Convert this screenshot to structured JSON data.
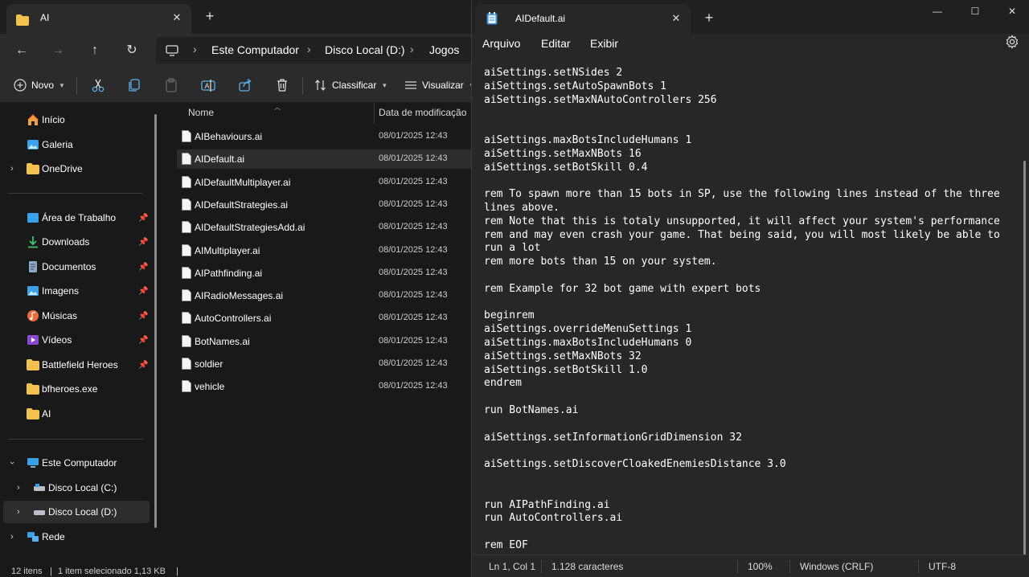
{
  "explorer": {
    "tab_title": "AI",
    "tab_close": "✕",
    "new_tab": "+",
    "nav": {
      "back": "←",
      "forward": "→",
      "up": "↑",
      "refresh": "↻"
    },
    "breadcrumb": [
      "Este Computador",
      "Disco Local (D:)",
      "Jogos"
    ],
    "toolbar": {
      "new_label": "Novo",
      "sort_label": "Classificar",
      "view_label": "Visualizar"
    },
    "sidebar": {
      "quick": [
        {
          "label": "Início",
          "icon": "home-icon"
        },
        {
          "label": "Galeria",
          "icon": "gallery-icon"
        },
        {
          "label": "OneDrive",
          "icon": "folder-icon"
        }
      ],
      "pinned": [
        {
          "label": "Área de Trabalho",
          "icon": "desktop-icon",
          "color": "#3aa0e8"
        },
        {
          "label": "Downloads",
          "icon": "download-icon",
          "color": "#3ec46d"
        },
        {
          "label": "Documentos",
          "icon": "documents-icon",
          "color": "#8fa7c7"
        },
        {
          "label": "Imagens",
          "icon": "images-icon",
          "color": "#3aa0e8"
        },
        {
          "label": "Músicas",
          "icon": "music-icon",
          "color": "#e86a3a"
        },
        {
          "label": "Vídeos",
          "icon": "videos-icon",
          "color": "#8a4ad0"
        },
        {
          "label": "Battlefield Heroes",
          "icon": "folder-icon",
          "color": "#f2c14e"
        },
        {
          "label": "bfheroes.exe",
          "icon": "folder-icon",
          "color": "#f2c14e"
        },
        {
          "label": "AI",
          "icon": "folder-icon",
          "color": "#f2c14e"
        }
      ],
      "drives": [
        {
          "label": "Este Computador",
          "icon": "pc-icon"
        },
        {
          "label": "Disco Local (C:)",
          "icon": "drive-icon"
        },
        {
          "label": "Disco Local (D:)",
          "icon": "drive-icon"
        },
        {
          "label": "Rede",
          "icon": "network-icon"
        }
      ]
    },
    "columns": {
      "name": "Nome",
      "date": "Data de modificação"
    },
    "files": [
      {
        "name": "AIBehaviours.ai",
        "date": "08/01/2025 12:43"
      },
      {
        "name": "AIDefault.ai",
        "date": "08/01/2025 12:43"
      },
      {
        "name": "AIDefaultMultiplayer.ai",
        "date": "08/01/2025 12:43"
      },
      {
        "name": "AIDefaultStrategies.ai",
        "date": "08/01/2025 12:43"
      },
      {
        "name": "AIDefaultStrategiesAdd.ai",
        "date": "08/01/2025 12:43"
      },
      {
        "name": "AIMultiplayer.ai",
        "date": "08/01/2025 12:43"
      },
      {
        "name": "AIPathfinding.ai",
        "date": "08/01/2025 12:43"
      },
      {
        "name": "AIRadioMessages.ai",
        "date": "08/01/2025 12:43"
      },
      {
        "name": "AutoControllers.ai",
        "date": "08/01/2025 12:43"
      },
      {
        "name": "BotNames.ai",
        "date": "08/01/2025 12:43"
      },
      {
        "name": "soldier",
        "date": "08/01/2025 12:43"
      },
      {
        "name": "vehicle",
        "date": "08/01/2025 12:43"
      }
    ],
    "status": {
      "count": "12 itens",
      "sep": "|",
      "selection": "1 item selecionado 1,13 KB",
      "sep2": "|"
    }
  },
  "notepad": {
    "tab_title": "AIDefault.ai",
    "tab_close": "✕",
    "new_tab": "+",
    "window": {
      "minimize": "—",
      "maximize": "☐",
      "close": "✕"
    },
    "menu": {
      "file": "Arquivo",
      "edit": "Editar",
      "view": "Exibir"
    },
    "content": "aiSettings.setNSides 2\naiSettings.setAutoSpawnBots 1\naiSettings.setMaxNAutoControllers 256\n\n\naiSettings.maxBotsIncludeHumans 1\naiSettings.setMaxNBots 16\naiSettings.setBotSkill 0.4\n\nrem To spawn more than 15 bots in SP, use the following lines instead of the three lines above.\nrem Note that this is totaly unsupported, it will affect your system's performance\nrem and may even crash your game. That being said, you will most likely be able to run a lot\nrem more bots than 15 on your system.\n\nrem Example for 32 bot game with expert bots\n\nbeginrem\naiSettings.overrideMenuSettings 1\naiSettings.maxBotsIncludeHumans 0\naiSettings.setMaxNBots 32\naiSettings.setBotSkill 1.0\nendrem\n\nrun BotNames.ai\n\naiSettings.setInformationGridDimension 32\n\naiSettings.setDiscoverCloakedEnemiesDistance 3.0\n\n\nrun AIPathFinding.ai\nrun AutoControllers.ai\n\nrem EOF",
    "status": {
      "position": "Ln 1, Col 1",
      "chars": "1.128 caracteres",
      "zoom": "100%",
      "line_ending": "Windows (CRLF)",
      "encoding": "UTF-8"
    }
  },
  "colors": {
    "folder": "#f2c14e",
    "accent": "#3aa0e8"
  }
}
